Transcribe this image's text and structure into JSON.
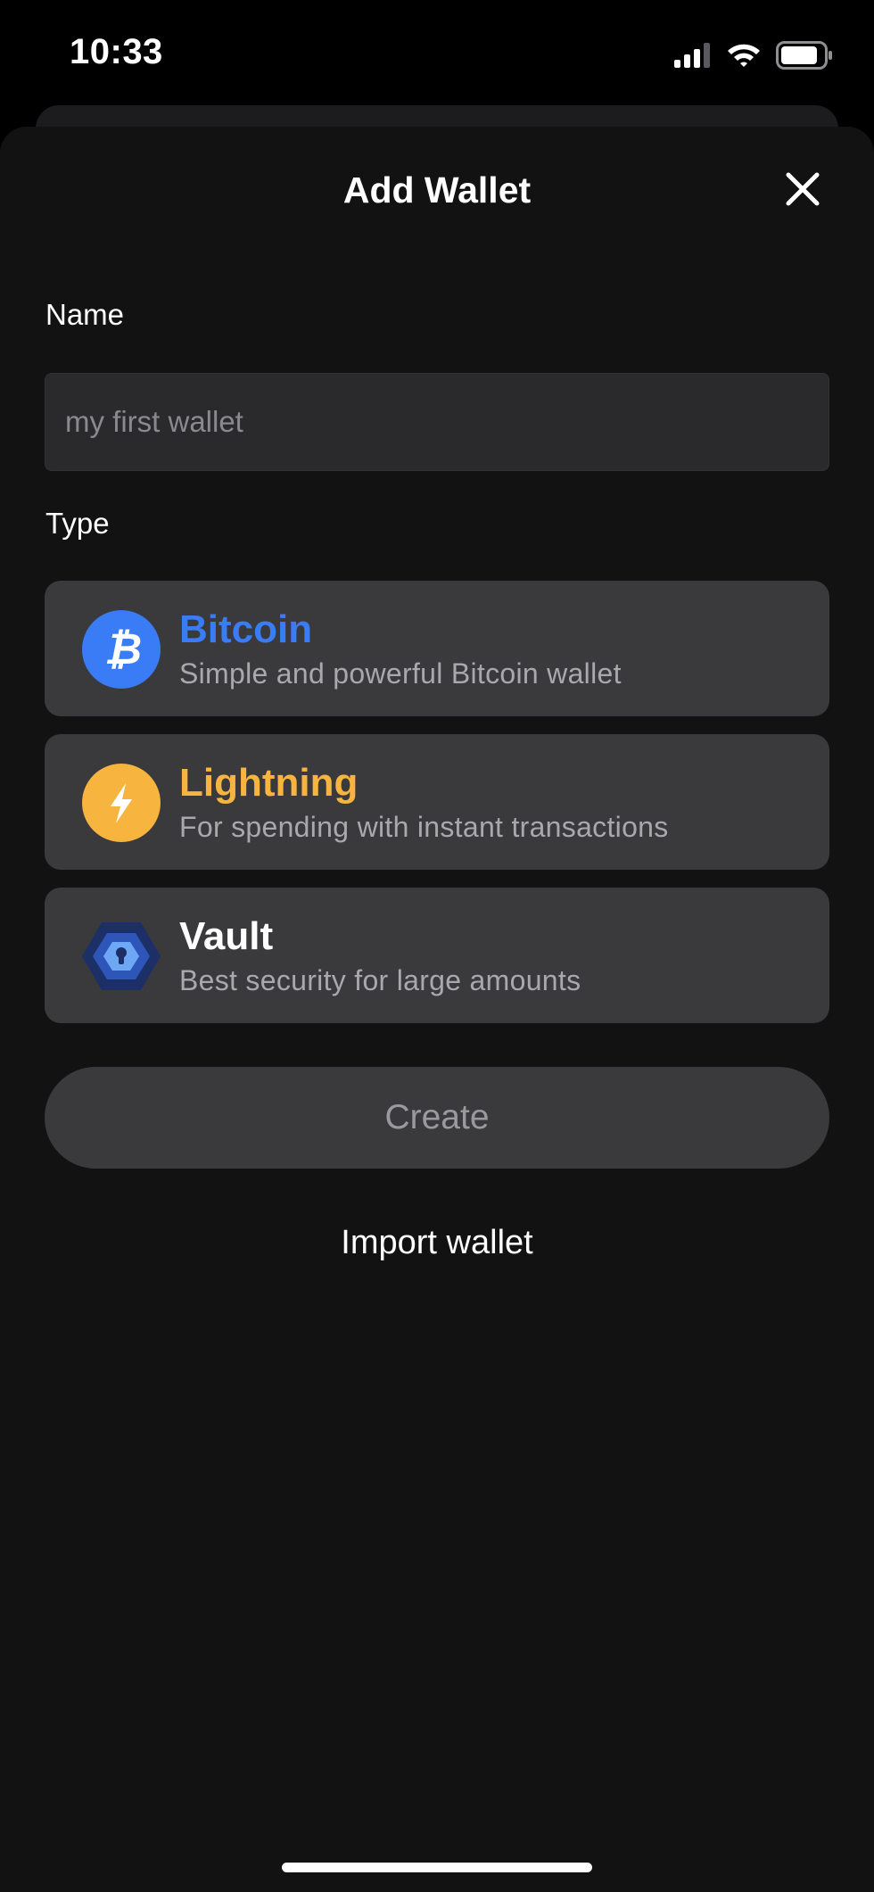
{
  "status_bar": {
    "time": "10:33",
    "icons": [
      "cellular-signal-icon",
      "wifi-icon",
      "battery-icon"
    ]
  },
  "sheet": {
    "title": "Add Wallet",
    "close_icon": "close-icon"
  },
  "name_field": {
    "label": "Name",
    "placeholder": "my first wallet",
    "value": ""
  },
  "type_section": {
    "label": "Type",
    "options": [
      {
        "title": "Bitcoin",
        "description": "Simple and powerful Bitcoin wallet",
        "icon": "bitcoin-icon",
        "color": "#3a7cf5"
      },
      {
        "title": "Lightning",
        "description": "For spending with instant transactions",
        "icon": "lightning-icon",
        "color": "#f7b43f"
      },
      {
        "title": "Vault",
        "description": "Best security for large amounts",
        "icon": "vault-icon",
        "color": "#ffffff"
      }
    ]
  },
  "actions": {
    "create_label": "Create",
    "import_label": "Import wallet"
  },
  "colors": {
    "background": "#121212",
    "card": "#3a3a3c",
    "input": "#2a2a2c",
    "bitcoin_blue": "#3a7cf5",
    "lightning_yellow": "#f7b43f"
  }
}
